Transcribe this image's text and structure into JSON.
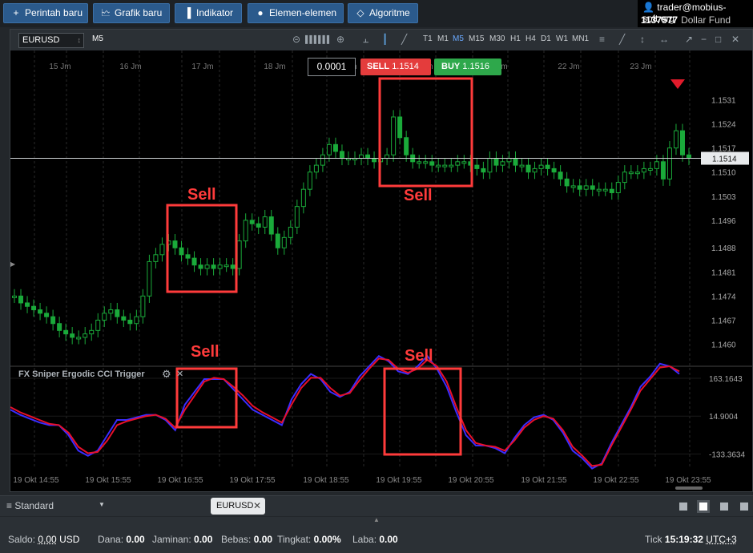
{
  "toolbar": {
    "new_order": "Perintah baru",
    "new_chart": "Grafik baru",
    "indicators": "Indikator",
    "elements": "Elemen-elemen",
    "algorithms": "Algoritme"
  },
  "account": {
    "user": "trader@mobius-soft.org",
    "account_id": "1137577",
    "fund_label": "Dollar Fund"
  },
  "chart": {
    "symbol": "EURUSD",
    "timeframe_label": "M5",
    "timeframes": [
      "T1",
      "M1",
      "M5",
      "M15",
      "M30",
      "H1",
      "H4",
      "D1",
      "W1",
      "MN1"
    ],
    "active_timeframe": "M5",
    "quantity": "0.0001",
    "sell_label": "SELL",
    "sell_price": "1.1514",
    "buy_label": "BUY",
    "buy_price": "1.1516",
    "current_price": "1.1514",
    "top_date_labels": [
      "15 Jm",
      "16 Jm",
      "17 Jm",
      "18 Jm",
      "19 Jm",
      "20 Jm",
      "21 Jm",
      "22 Jm",
      "23 Jm"
    ],
    "bottom_time_labels": [
      "19 Okt 14:55",
      "19 Okt 15:55",
      "19 Okt 16:55",
      "19 Okt 17:55",
      "19 Okt 18:55",
      "19 Okt 19:55",
      "19 Okt 20:55",
      "19 Okt 21:55",
      "19 Okt 22:55",
      "19 Okt 23:55"
    ],
    "annotations": [
      "Sell",
      "Sell",
      "Sell",
      "Sell"
    ],
    "colors": {
      "bull": "#1aaa3a",
      "line_blue": "#3b2cff",
      "line_red": "#e8102a",
      "annotation": "#ff3b3b",
      "sell_bg": "#e43c3c",
      "buy_bg": "#2ea84b"
    }
  },
  "chart_data": [
    {
      "type": "candlestick",
      "title": "EURUSD M5",
      "y_tick_labels": [
        "1.1531",
        "1.1524",
        "1.1517",
        "1.1510",
        "1.1503",
        "1.1496",
        "1.1488",
        "1.1481",
        "1.1474",
        "1.1467",
        "1.1460"
      ],
      "ylim": [
        1.1455,
        1.1536
      ],
      "close": [
        1.1474,
        1.1472,
        1.1471,
        1.147,
        1.1469,
        1.1468,
        1.1466,
        1.1464,
        1.1463,
        1.1462,
        1.1462,
        1.1463,
        1.1464,
        1.1467,
        1.1469,
        1.147,
        1.1468,
        1.1467,
        1.1466,
        1.1468,
        1.1474,
        1.1484,
        1.1486,
        1.1489,
        1.149,
        1.1488,
        1.1486,
        1.1485,
        1.1483,
        1.1482,
        1.1483,
        1.1482,
        1.1483,
        1.1483,
        1.1482,
        1.149,
        1.1496,
        1.1495,
        1.1494,
        1.1497,
        1.1492,
        1.1488,
        1.1491,
        1.1494,
        1.15,
        1.1505,
        1.151,
        1.1512,
        1.1515,
        1.1518,
        1.1516,
        1.1514,
        1.1514,
        1.1514,
        1.1515,
        1.1514,
        1.1513,
        1.1514,
        1.1515,
        1.1526,
        1.152,
        1.1515,
        1.1513,
        1.1513,
        1.1513,
        1.1512,
        1.1512,
        1.1512,
        1.1512,
        1.1513,
        1.1513,
        1.1512,
        1.1511,
        1.151,
        1.1514,
        1.1512,
        1.1513,
        1.1514,
        1.1512,
        1.1512,
        1.151,
        1.1511,
        1.1512,
        1.1511,
        1.151,
        1.1508,
        1.1506,
        1.1506,
        1.1505,
        1.1506,
        1.1505,
        1.1505,
        1.1505,
        1.1504,
        1.1507,
        1.151,
        1.151,
        1.151,
        1.1511,
        1.1511,
        1.1513,
        1.1508,
        1.1517,
        1.1522,
        1.1515,
        1.1514
      ]
    },
    {
      "type": "line",
      "title": "FX Sniper Ergodic CCI Trigger",
      "y_tick_labels": [
        "163.1643",
        "14.9004",
        "-133.3634"
      ],
      "series": [
        {
          "name": "",
          "color": "#3b2cff",
          "values": [
            40,
            20,
            5,
            -10,
            -20,
            -20,
            -60,
            -120,
            -140,
            -120,
            -60,
            0,
            0,
            10,
            20,
            20,
            0,
            -40,
            60,
            110,
            160,
            160,
            160,
            120,
            80,
            40,
            20,
            0,
            -20,
            80,
            140,
            180,
            160,
            110,
            90,
            110,
            170,
            210,
            250,
            230,
            190,
            180,
            210,
            250,
            200,
            130,
            30,
            -60,
            -100,
            -100,
            -110,
            -130,
            -70,
            -20,
            10,
            20,
            0,
            -50,
            -120,
            -150,
            -190,
            -170,
            -90,
            -20,
            50,
            130,
            170,
            220,
            210,
            180
          ]
        },
        {
          "name": "",
          "color": "#e8102a",
          "values": [
            50,
            30,
            15,
            0,
            -15,
            -20,
            -50,
            -105,
            -130,
            -125,
            -80,
            -20,
            -5,
            5,
            15,
            20,
            5,
            -30,
            40,
            95,
            150,
            165,
            160,
            130,
            95,
            55,
            30,
            10,
            -10,
            60,
            125,
            165,
            165,
            125,
            95,
            105,
            155,
            200,
            240,
            235,
            200,
            185,
            200,
            235,
            210,
            150,
            50,
            -40,
            -90,
            -100,
            -105,
            -120,
            -80,
            -30,
            0,
            15,
            5,
            -40,
            -105,
            -140,
            -180,
            -175,
            -100,
            -30,
            40,
            115,
            160,
            205,
            210,
            190
          ]
        }
      ]
    }
  ],
  "bottom": {
    "workspace": "Standard",
    "symbol_tab": "EURUSD"
  },
  "status": {
    "balance_label": "Saldo:",
    "balance_value": "0.00",
    "balance_currency": "USD",
    "funds_label": "Dana:",
    "funds_value": "0.00",
    "margin_label": "Jaminan:",
    "margin_value": "0.00",
    "free_label": "Bebas:",
    "free_value": "0.00",
    "level_label": "Tingkat:",
    "level_value": "0.00%",
    "profit_label": "Laba:",
    "profit_value": "0.00",
    "tick_label": "Tick",
    "time": "15:19:32",
    "timezone": "UTC+3"
  }
}
